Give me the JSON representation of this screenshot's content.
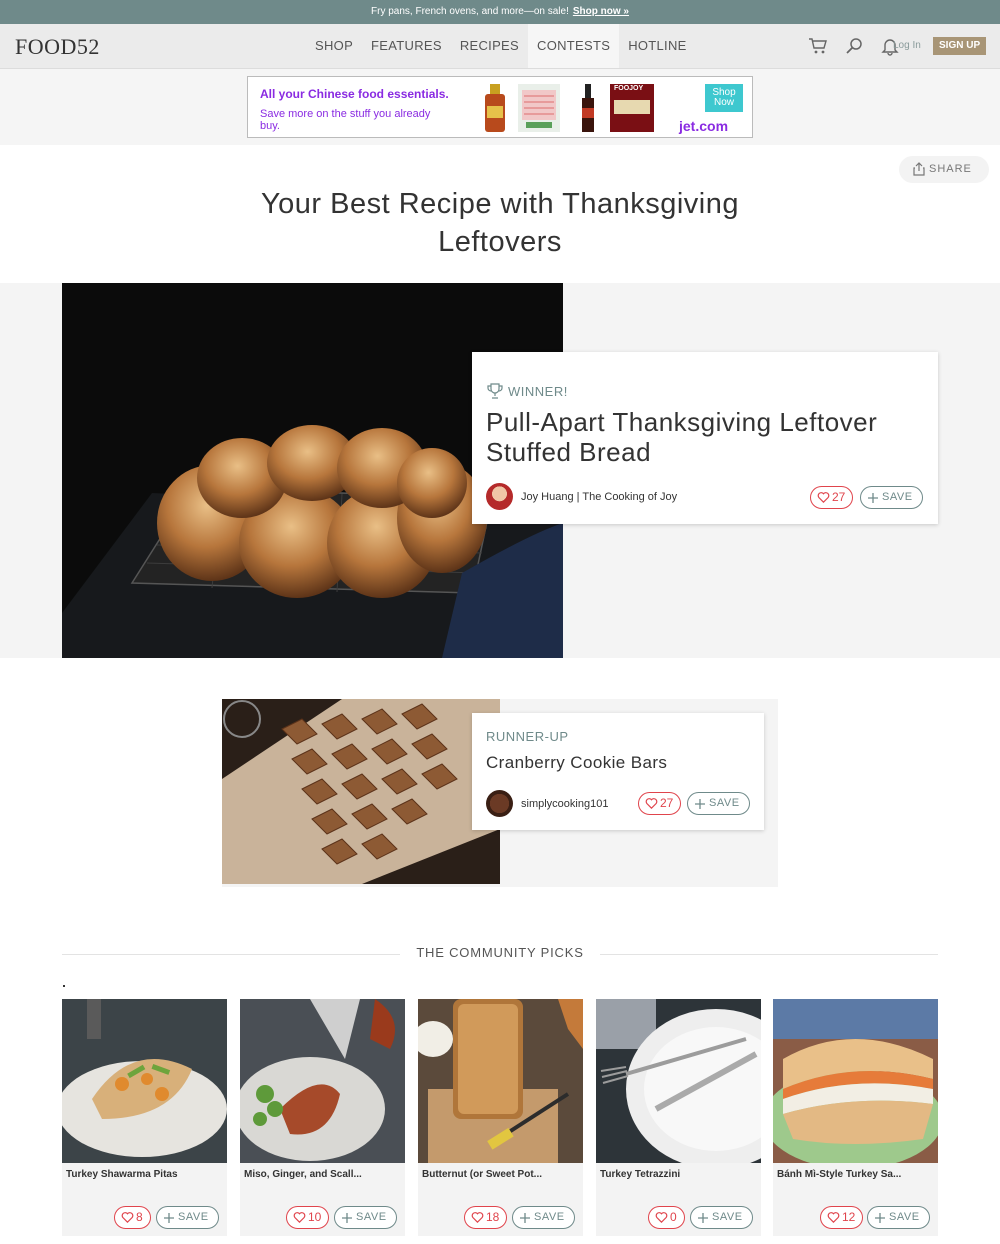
{
  "promo": {
    "text": "Fry pans, French ovens, and more—on sale!",
    "link": "Shop now »"
  },
  "nav": {
    "logo": "FOOD52",
    "links": [
      "SHOP",
      "FEATURES",
      "RECIPES",
      "CONTESTS",
      "HOTLINE"
    ],
    "active": "CONTESTS",
    "icons": [
      "cart-icon",
      "search-icon",
      "bell-icon"
    ],
    "login": "Log In",
    "signup": "SIGN UP"
  },
  "ad": {
    "headline": "All your Chinese food essentials.",
    "subline": "Save more on the stuff you already buy.",
    "shop": "Shop Now",
    "brand": "jet.com",
    "product_label": "FOOJOY",
    "accent": "#8a2be2"
  },
  "share": "SHARE",
  "page_title": "Your Best Recipe with Thanksgiving Leftovers",
  "winner": {
    "tag": "WINNER!",
    "title": "Pull-Apart Thanksgiving Leftover Stuffed Bread",
    "author": "Joy Huang | The Cooking of Joy",
    "likes": "27",
    "save": "SAVE"
  },
  "runner_up": {
    "tag": "RUNNER-UP",
    "title": "Cranberry Cookie Bars",
    "author": "simplycooking101",
    "likes": "27",
    "save": "SAVE"
  },
  "community": {
    "heading": "THE COMMUNITY PICKS",
    "picks": [
      {
        "name": "Turkey Shawarma Pitas",
        "likes": "8",
        "save": "SAVE"
      },
      {
        "name": "Miso, Ginger, and Scall...",
        "likes": "10",
        "save": "SAVE"
      },
      {
        "name": "Butternut (or Sweet Pot...",
        "likes": "18",
        "save": "SAVE"
      },
      {
        "name": "Turkey Tetrazzini",
        "likes": "0",
        "save": "SAVE"
      },
      {
        "name": "Bánh Mì-Style Turkey Sa...",
        "likes": "12",
        "save": "SAVE"
      }
    ]
  },
  "colors": {
    "teal": "#6f8a8a",
    "heart": "#e0444c",
    "signup": "#a89576"
  }
}
